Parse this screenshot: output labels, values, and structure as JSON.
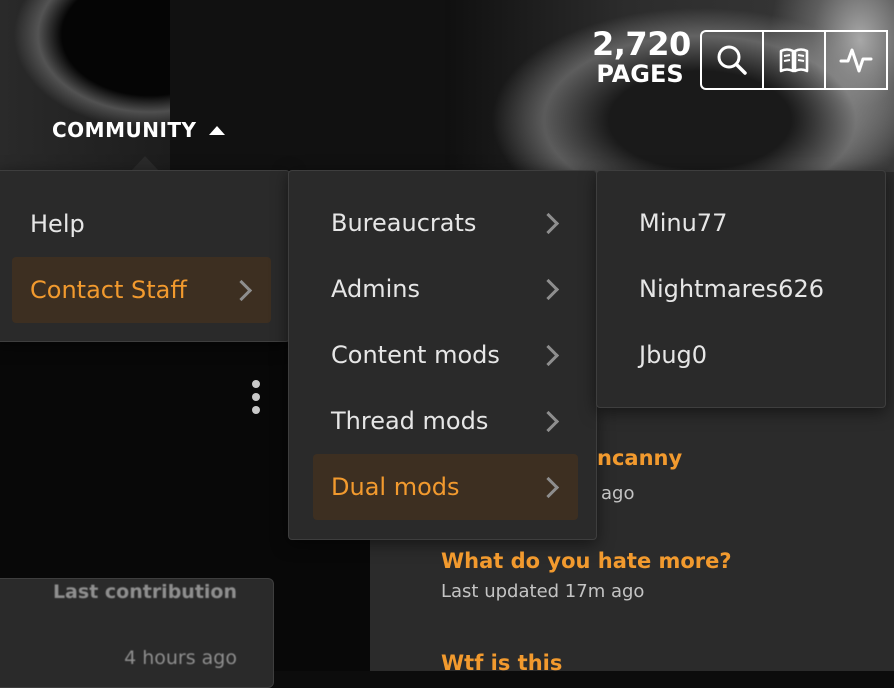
{
  "header": {
    "pages_count": "2,720",
    "pages_label": "PAGES",
    "nav_label": "COMMUNITY",
    "toolbar": [
      {
        "icon": "search-icon"
      },
      {
        "icon": "book-icon"
      },
      {
        "icon": "activity-icon"
      }
    ]
  },
  "menu_level1": {
    "items": [
      "Help",
      "Contact Staff"
    ],
    "active": "Contact Staff"
  },
  "menu_level2": {
    "items": [
      "Bureaucrats",
      "Admins",
      "Content mods",
      "Thread mods",
      "Dual mods"
    ],
    "active": "Dual mods"
  },
  "menu_level3": {
    "items": [
      "Minu77",
      "Nightmares626",
      "Jbug0"
    ]
  },
  "feed": [
    {
      "title": "ncanny",
      "meta": "ago"
    },
    {
      "title": "What do you hate more?",
      "meta": "Last updated 17m ago"
    },
    {
      "title": "Wtf is this",
      "meta": ""
    }
  ],
  "contribution": {
    "label": "Last contribution",
    "time": "4 hours ago"
  },
  "colors": {
    "accent": "#f29a2e",
    "menu_bg": "#2a2a2a",
    "active_bg": "#3d2f21"
  }
}
